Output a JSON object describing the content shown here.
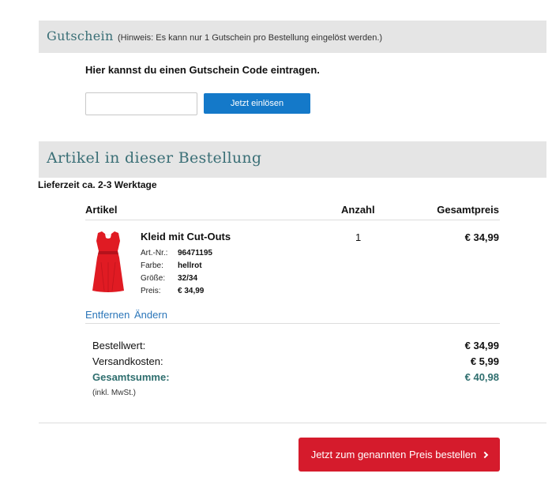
{
  "voucher": {
    "title": "Gutschein",
    "hint": "(Hinweis: Es kann nur 1 Gutschein pro Bestellung eingelöst werden.)",
    "instruction": "Hier kannst du einen Gutschein Code eintragen.",
    "input_value": "",
    "input_placeholder": "",
    "redeem_label": "Jetzt einlösen"
  },
  "articles": {
    "title": "Artikel in dieser Bestellung",
    "delivery_time": "Lieferzeit ca. 2-3 Werktage",
    "columns": [
      "Artikel",
      "Anzahl",
      "Gesamtpreis"
    ],
    "items": [
      {
        "name": "Kleid mit Cut-Outs",
        "image_icon": "red-dress-image",
        "attributes": [
          {
            "label": "Art.-Nr.:",
            "value": "96471195"
          },
          {
            "label": "Farbe:",
            "value": "hellrot"
          },
          {
            "label": "Größe:",
            "value": "32/34"
          },
          {
            "label": "Preis:",
            "value": "€ 34,99"
          }
        ],
        "quantity": "1",
        "total": "€ 34,99",
        "actions": {
          "remove": "Entfernen",
          "change": "Ändern"
        }
      }
    ]
  },
  "summary": {
    "order_value_label": "Bestellwert:",
    "order_value": "€ 34,99",
    "shipping_label": "Versandkosten:",
    "shipping_value": "€ 5,99",
    "grand_total_label": "Gesamtsumme:",
    "grand_total_value": "€ 40,98",
    "vat_note": "(inkl. MwSt.)"
  },
  "order_button": {
    "label": "Jetzt zum genannten Preis bestellen",
    "icon": "chevron-right-icon"
  },
  "colors": {
    "section_band": "#e5e5e5",
    "section_title": "#3a6f76",
    "redeem_button": "#1479c9",
    "order_button": "#d51b2c",
    "link": "#2b76b9",
    "grand_total": "#2e6e6e",
    "dress": "#e01b23"
  }
}
